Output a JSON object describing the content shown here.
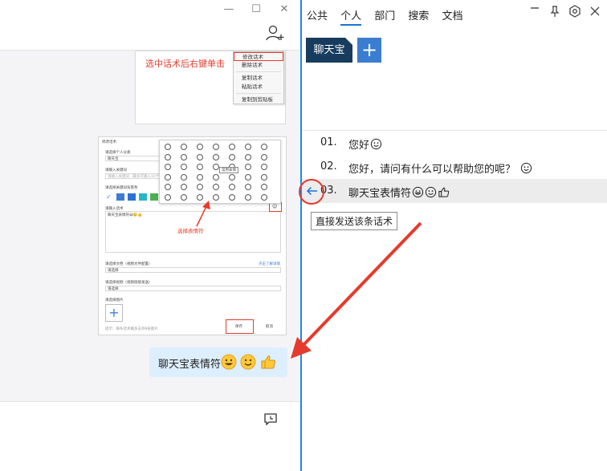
{
  "left_window": {
    "window_controls": {
      "minimize": "—",
      "maximize": "☐",
      "close": "✕"
    },
    "screenshot1": {
      "note": "选中话术后右键单击",
      "context_menu": [
        "修改话术",
        "删除话术",
        "复制话术",
        "粘贴话术",
        "复制到剪贴板"
      ]
    },
    "screenshot2": {
      "title": "修改话术",
      "labels": [
        "请选择个人分类",
        "请输入关键词",
        "请选择关键词背景色",
        "请输入话术",
        "请选择文档（视频文件配置）",
        "请选择视频（视频链接发送）",
        "请选择图片"
      ],
      "values": [
        "聊天宝",
        "请输入关键词（最多可输入10个）",
        "聊天宝表情符😀🙂👍",
        "请选择",
        "请选择"
      ],
      "tooltip": "常用表情",
      "link": "点击了解详情",
      "hint": "提示：每条话术最多支持9张图片",
      "note": "选择表情符",
      "save": "保存",
      "cancel": "取消"
    },
    "bubble_text": "聊天宝表情符"
  },
  "right_panel": {
    "tabs": [
      "公共",
      "个人",
      "部门",
      "搜索",
      "文档"
    ],
    "active_tab": "个人",
    "category_active": "聊天宝",
    "add_label": "+",
    "phrases": [
      {
        "num": "01.",
        "text": "您好"
      },
      {
        "num": "02.",
        "text": "您好，请问有什么可以帮助您的呢？"
      },
      {
        "num": "03.",
        "text": "聊天宝表情符"
      }
    ],
    "tooltip": "直接发送该条话术"
  },
  "colors": {
    "accent": "#1e88e5",
    "annotation_red": "#e53b2c",
    "category_bg": "#173c5e",
    "bubble_bg": "#ddeeff",
    "emoji_yellow": "#ffc93c"
  }
}
